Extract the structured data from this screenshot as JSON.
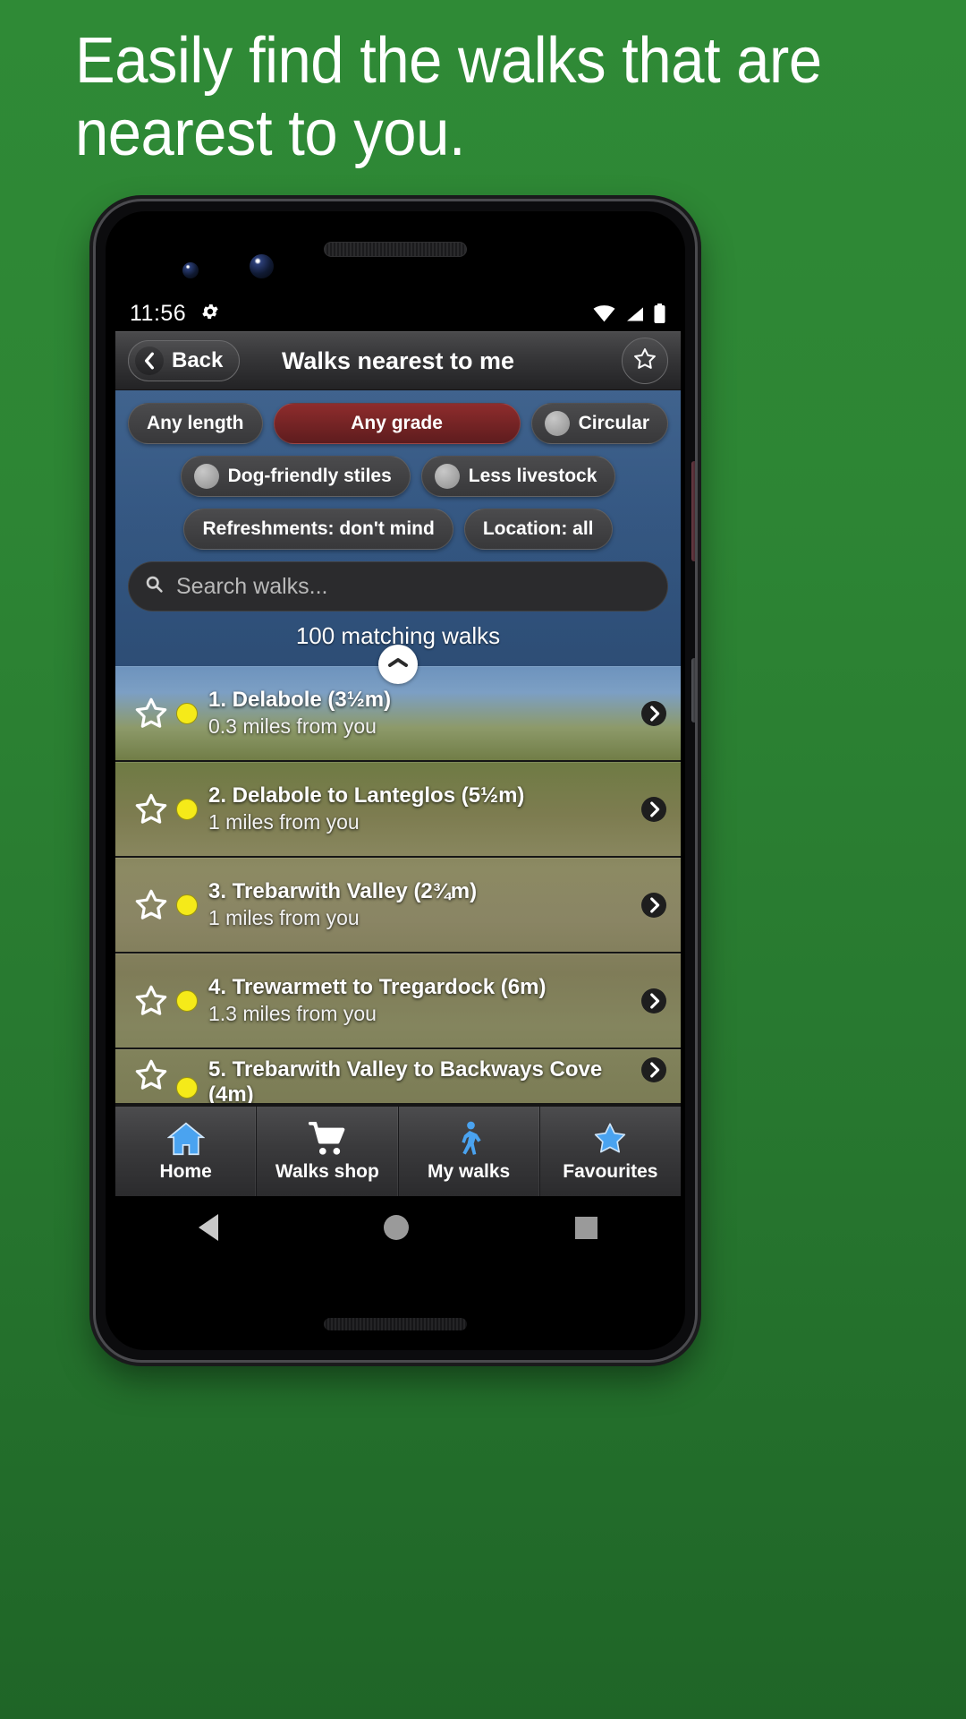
{
  "promo": {
    "headline": "Easily find the walks that are nearest to you."
  },
  "status_bar": {
    "time": "11:56",
    "gear_icon": "gear-icon",
    "wifi_icon": "wifi-icon",
    "signal_icon": "signal-icon",
    "battery_icon": "battery-icon"
  },
  "toolbar": {
    "back_label": "Back",
    "back_icon": "chevron-left-icon",
    "title": "Walks nearest to me",
    "favourite_icon": "star-outline-icon"
  },
  "filters": {
    "chips_row1": [
      {
        "label": "Any length",
        "style": "dark",
        "toggle": false
      },
      {
        "label": "Any grade",
        "style": "red",
        "toggle": false
      },
      {
        "label": "Circular",
        "style": "dark",
        "toggle": true
      }
    ],
    "chips_row2": [
      {
        "label": "Dog-friendly stiles",
        "style": "dark",
        "toggle": true
      },
      {
        "label": "Less livestock",
        "style": "dark",
        "toggle": true
      }
    ],
    "chips_row3": [
      {
        "label": "Refreshments: don't mind",
        "style": "dark",
        "toggle": false
      },
      {
        "label": "Location: all",
        "style": "dark",
        "toggle": false
      }
    ]
  },
  "search": {
    "placeholder": "Search walks...",
    "value": "",
    "icon": "search-icon"
  },
  "results": {
    "count_text": "100 matching walks",
    "collapse_icon": "chevron-up-icon",
    "items": [
      {
        "title": "1. Delabole (3½m)",
        "distance": "0.3 miles from you",
        "grade_color": "#f5ea19",
        "favourite": false
      },
      {
        "title": "2. Delabole to Lanteglos (5½m)",
        "distance": "1 miles from you",
        "grade_color": "#f5ea19",
        "favourite": false
      },
      {
        "title": "3. Trebarwith Valley (2¾m)",
        "distance": "1 miles from you",
        "grade_color": "#f5ea19",
        "favourite": false
      },
      {
        "title": "4. Trewarmett to Tregardock (6m)",
        "distance": "1.3 miles from you",
        "grade_color": "#f5ea19",
        "favourite": false
      },
      {
        "title": "5. Trebarwith Valley to Backways Cove (4m)",
        "distance": "",
        "grade_color": "#f5ea19",
        "favourite": false
      }
    ]
  },
  "bottom_nav": [
    {
      "label": "Home",
      "icon": "home-icon"
    },
    {
      "label": "Walks shop",
      "icon": "shopping-cart-icon"
    },
    {
      "label": "My walks",
      "icon": "walking-person-icon"
    },
    {
      "label": "Favourites",
      "icon": "star-filled-icon"
    }
  ],
  "android_nav": {
    "back_icon": "triangle-back-icon",
    "home_icon": "circle-home-icon",
    "recents_icon": "square-recents-icon"
  },
  "colors": {
    "promo_background": "#2d8534",
    "accent_red": "#8e2c2c",
    "nav_icon_blue": "#4aa3f0",
    "grade_yellow": "#f5ea19"
  }
}
